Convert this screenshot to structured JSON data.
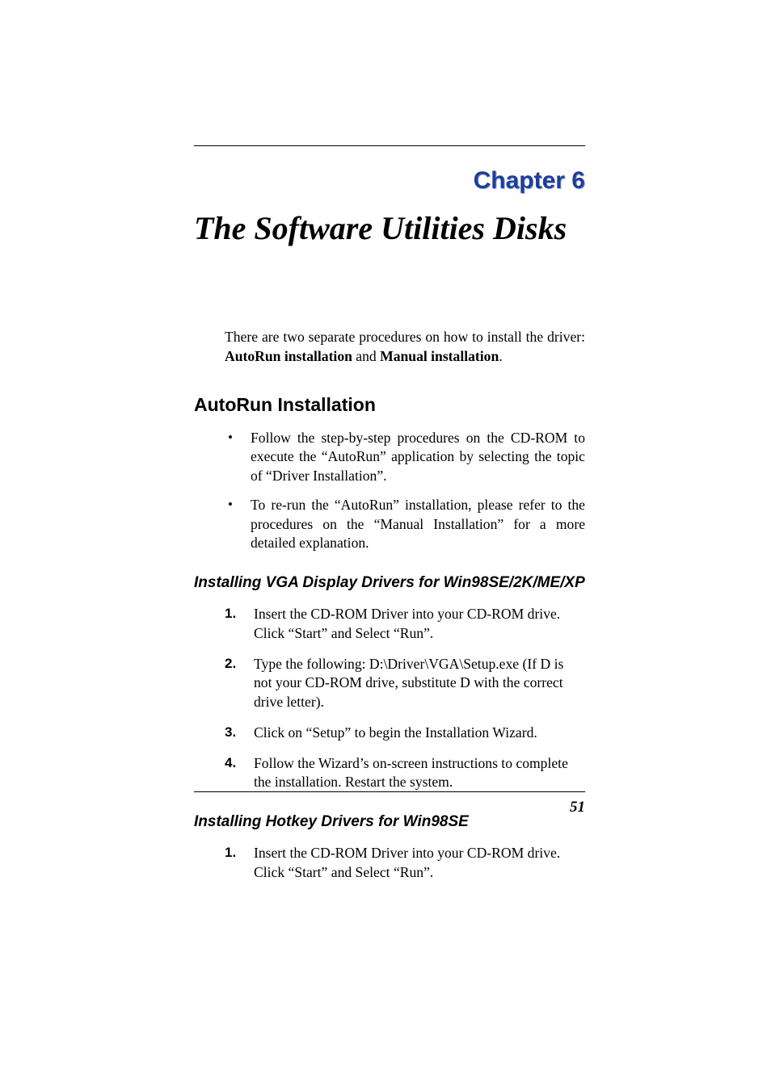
{
  "chapter": {
    "label": "Chapter 6",
    "title": "The Software Utilities Disks"
  },
  "intro": {
    "text_part1": "There are two separate procedures on how to install the driver: ",
    "bold1": "AutoRun installation",
    "text_part2": " and ",
    "bold2": "Manual installation",
    "text_part3": "."
  },
  "section1": {
    "heading": "AutoRun Installation",
    "bullets": [
      "Follow the step-by-step procedures on the CD-ROM to execute the “AutoRun” application by selecting the topic of “Driver Installation”.",
      "To re-run the “AutoRun” installation, please refer to the procedures on the “Manual Installation” for a more detailed explanation."
    ]
  },
  "subsection1": {
    "heading": "Installing VGA Display Drivers for Win98SE/2K/ME/XP",
    "items": [
      {
        "num": "1.",
        "text": "Insert the CD-ROM Driver into your CD-ROM drive.  Click “Start” and Select “Run”."
      },
      {
        "num": "2.",
        "text": "Type the following: D:\\Driver\\VGA\\Setup.exe (If D is not your CD-ROM drive, substitute D with the correct drive letter)."
      },
      {
        "num": "3.",
        "text": "Click on “Setup” to begin the Installation Wizard."
      },
      {
        "num": "4.",
        "text": "Follow the Wizard’s on-screen instructions to complete the installation.  Restart the system."
      }
    ]
  },
  "subsection2": {
    "heading": "Installing Hotkey Drivers for Win98SE",
    "items": [
      {
        "num": "1.",
        "text": "Insert the CD-ROM Driver into your CD-ROM drive.  Click “Start” and Select “Run”."
      }
    ]
  },
  "page_number": "51"
}
